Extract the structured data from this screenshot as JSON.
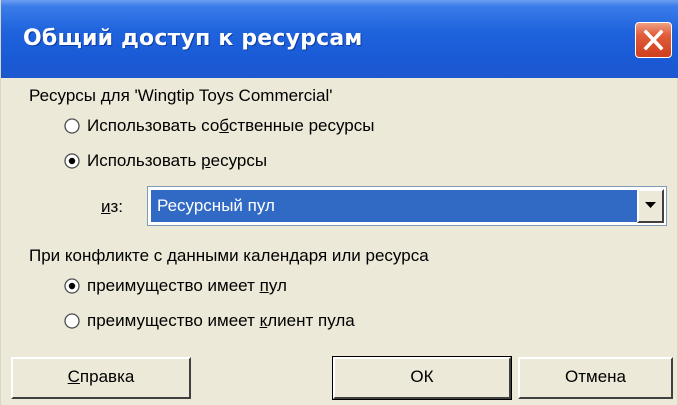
{
  "window": {
    "title": "Общий доступ к ресурсам"
  },
  "resources": {
    "group_label": "Ресурсы для 'Wingtip Toys Commercial'",
    "option_own": {
      "pre": "Использовать со",
      "accel": "б",
      "post": "ственные ресурсы",
      "checked": false
    },
    "option_pool": {
      "pre": "Использовать ",
      "accel": "р",
      "post": "есурсы",
      "checked": true
    },
    "from_label": {
      "accel": "и",
      "post": "з:"
    },
    "from_select": {
      "selected": "Ресурсный пул"
    }
  },
  "conflict": {
    "group_label": "При конфликте с данными календаря или ресурса",
    "option_pool": {
      "pre": "преимущество имеет ",
      "accel": "п",
      "post": "ул",
      "checked": true
    },
    "option_client": {
      "pre": "преимущество имеет ",
      "accel": "к",
      "post": "лиент пула",
      "checked": false
    }
  },
  "buttons": {
    "help": {
      "accel": "С",
      "post": "правка"
    },
    "ok": {
      "label": "ОК"
    },
    "cancel": {
      "label": "Отмена"
    }
  },
  "colors": {
    "title_bar": "#1f63dd",
    "dialog_face": "#ece9d8",
    "selection": "#316ac5",
    "close_button": "#e15d3b"
  },
  "icons": {
    "close": "close-icon",
    "dropdown": "chevron-down-icon",
    "radio": "radio-button-icon"
  }
}
